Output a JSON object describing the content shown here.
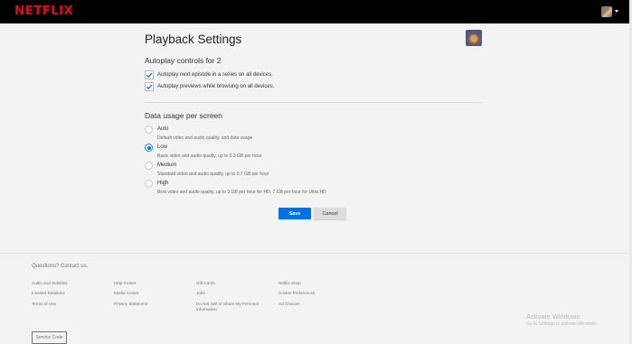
{
  "header": {
    "logo_text": "NETFLIX",
    "brand_color": "#e50914"
  },
  "main": {
    "title": "Playback Settings",
    "autoplay": {
      "heading": "Autoplay controls for 2",
      "options": [
        {
          "label": "Autoplay next episode in a series on all devices.",
          "checked": true
        },
        {
          "label": "Autoplay previews while browsing on all devices.",
          "checked": true
        }
      ]
    },
    "data_usage": {
      "heading": "Data usage per screen",
      "options": [
        {
          "label": "Auto",
          "description": "Default video and audio quality, and data usage",
          "selected": false
        },
        {
          "label": "Low",
          "description": "Basic video and audio quality, up to 0.3 GB per hour",
          "selected": true
        },
        {
          "label": "Medium",
          "description": "Standard video and audio quality, up to 0.7 GB per hour",
          "selected": false
        },
        {
          "label": "High",
          "description": "Best video and audio quality, up to 3 GB per hour for HD, 7 GB per hour for Ultra HD",
          "selected": false
        }
      ]
    },
    "buttons": {
      "save": "Save",
      "cancel": "Cancel"
    },
    "accent_color": "#0071eb"
  },
  "footer": {
    "contact": "Questions? Contact us.",
    "links": [
      "Audio and Subtitles",
      "Help Center",
      "Gift Cards",
      "Netflix Shop",
      "Investor Relations",
      "Media Center",
      "Jobs",
      "Cookie Preferences",
      "Terms of Use",
      "Privacy Statement",
      "Do Not Sell or Share My Personal Information",
      "Ad Choices"
    ],
    "service_code": "Service Code"
  },
  "watermark": {
    "line1": "Activate Windows",
    "line2": "Go to Settings to activate Windows."
  }
}
